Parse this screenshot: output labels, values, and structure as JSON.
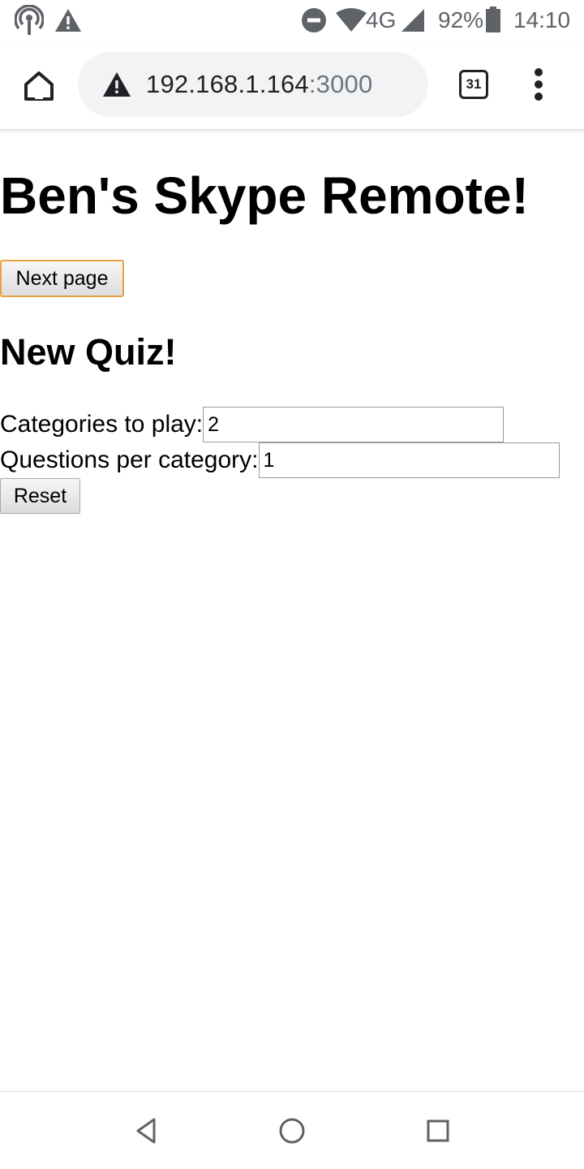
{
  "status_bar": {
    "battery_text": "92%",
    "time": "14:10",
    "network": "4G",
    "icons": [
      "hotspot-icon",
      "warning-icon",
      "do-not-disturb-icon",
      "wifi-icon",
      "signal-icon",
      "battery-icon"
    ]
  },
  "browser": {
    "url_host": "192.168.1.164",
    "url_port": ":3000",
    "tab_count": "31",
    "icons": [
      "home-icon",
      "not-secure-icon",
      "tab-switcher-icon",
      "more-menu-icon"
    ]
  },
  "page": {
    "title": "Ben's Skype Remote!",
    "next_button_label": "Next page",
    "quiz_heading": "New Quiz!",
    "categories_label": "Categories to play:",
    "categories_value": "2",
    "questions_label": "Questions per category:",
    "questions_value": "1",
    "reset_button_label": "Reset"
  },
  "nav_bar": {
    "icons": [
      "back-icon",
      "home-circle-icon",
      "recents-icon"
    ]
  },
  "colors": {
    "focus_outline": "#e8a33d",
    "omnibox_bg": "#f1f3f4"
  }
}
